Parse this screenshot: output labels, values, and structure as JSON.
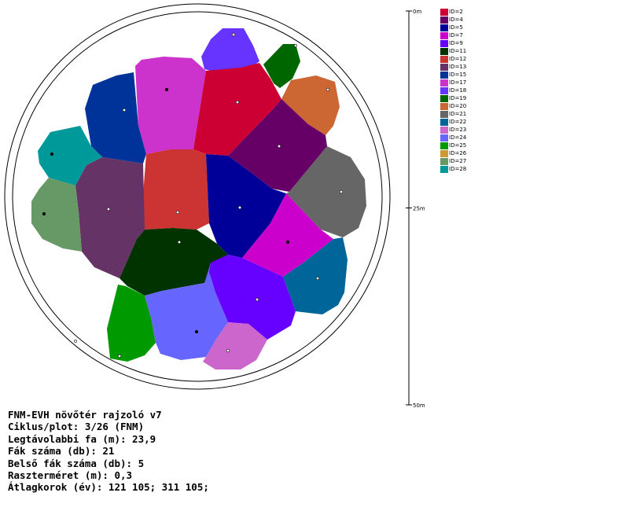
{
  "app_title": "FNM-EVH növőtér rajzoló v7",
  "info_lines": [
    "FNM-EVH növőtér rajzoló v7",
    "Ciklus/plot: 3/26 (FNM)",
    "Legtávolabbi fa (m): 23,9",
    "Fák száma (db): 21",
    "Belső fák száma (db): 5",
    "Raszterméret (m): 0,3",
    "Átlagkorok (év): 121 105; 311 105;"
  ],
  "scale": {
    "ticks": [
      {
        "label": "0m",
        "value": 0
      },
      {
        "label": "25m",
        "value": 25
      },
      {
        "label": "50m",
        "value": 50
      }
    ]
  },
  "legend": [
    {
      "label": "ID=2",
      "color": "#cc0033"
    },
    {
      "label": "ID=4",
      "color": "#660066"
    },
    {
      "label": "ID=5",
      "color": "#000099"
    },
    {
      "label": "ID=7",
      "color": "#cc00cc"
    },
    {
      "label": "ID=9",
      "color": "#6600ff"
    },
    {
      "label": "ID=11",
      "color": "#003300"
    },
    {
      "label": "ID=12",
      "color": "#cc3333"
    },
    {
      "label": "ID=13",
      "color": "#663366"
    },
    {
      "label": "ID=15",
      "color": "#003399"
    },
    {
      "label": "ID=17",
      "color": "#cc33cc"
    },
    {
      "label": "ID=18",
      "color": "#6633ff"
    },
    {
      "label": "ID=19",
      "color": "#006600"
    },
    {
      "label": "ID=20",
      "color": "#cc6633"
    },
    {
      "label": "ID=21",
      "color": "#666666"
    },
    {
      "label": "ID=22",
      "color": "#006699"
    },
    {
      "label": "ID=23",
      "color": "#cc66cc"
    },
    {
      "label": "ID=24",
      "color": "#6666ff"
    },
    {
      "label": "ID=25",
      "color": "#009900"
    },
    {
      "label": "ID=26",
      "color": "#cc9933"
    },
    {
      "label": "ID=27",
      "color": "#669966"
    },
    {
      "label": "ID=28",
      "color": "#009999"
    }
  ],
  "cells": [
    {
      "id": "ID=18",
      "color": "#6633ff"
    },
    {
      "id": "ID=19",
      "color": "#006600"
    },
    {
      "id": "ID=17",
      "color": "#cc33cc"
    },
    {
      "id": "ID=15",
      "color": "#003399"
    },
    {
      "id": "ID=2",
      "color": "#cc0033"
    },
    {
      "id": "ID=20",
      "color": "#cc6633"
    },
    {
      "id": "ID=28",
      "color": "#009999"
    },
    {
      "id": "ID=4",
      "color": "#660066"
    },
    {
      "id": "ID=12",
      "color": "#cc3333"
    },
    {
      "id": "ID=13",
      "color": "#663366"
    },
    {
      "id": "ID=27",
      "color": "#669966"
    },
    {
      "id": "ID=5",
      "color": "#000099"
    },
    {
      "id": "ID=21",
      "color": "#666666"
    },
    {
      "id": "ID=11",
      "color": "#003300"
    },
    {
      "id": "ID=7",
      "color": "#cc00cc"
    },
    {
      "id": "ID=22",
      "color": "#006699"
    },
    {
      "id": "ID=9",
      "color": "#6600ff"
    },
    {
      "id": "ID=25",
      "color": "#009900"
    },
    {
      "id": "ID=24",
      "color": "#6666ff"
    },
    {
      "id": "ID=23",
      "color": "#cc66cc"
    }
  ]
}
